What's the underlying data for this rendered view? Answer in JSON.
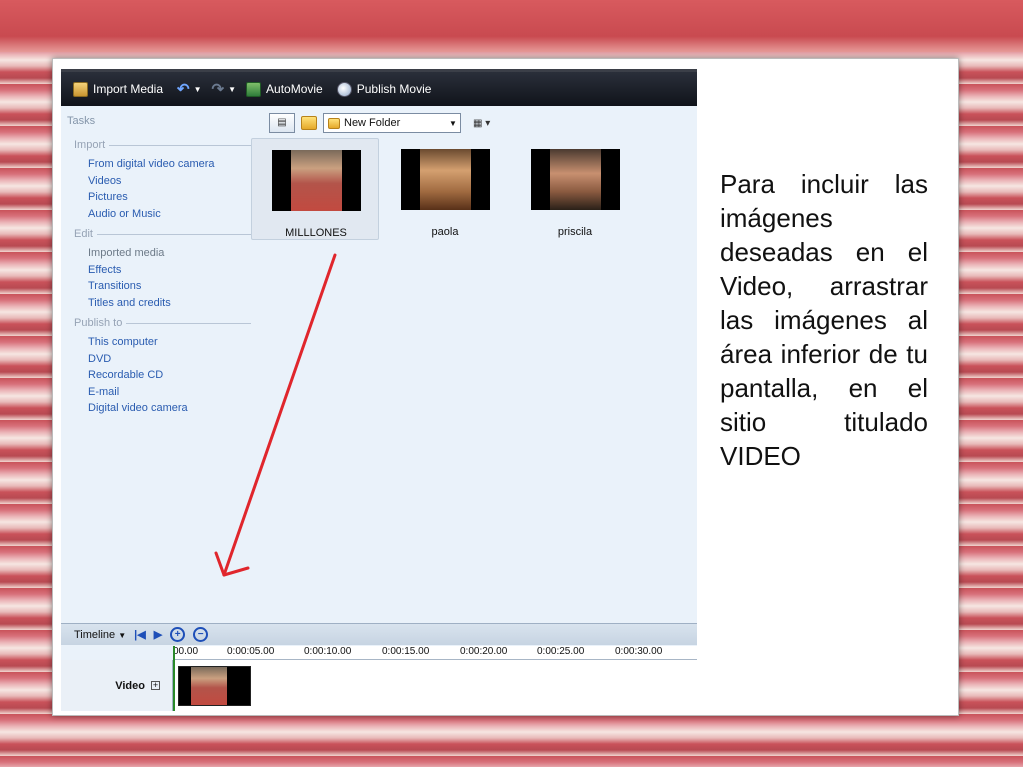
{
  "toolbar": {
    "import_media": "Import Media",
    "automovie": "AutoMovie",
    "publish_movie": "Publish Movie"
  },
  "tasks": {
    "title": "Tasks",
    "import": {
      "heading": "Import",
      "items": [
        "From digital video camera",
        "Videos",
        "Pictures",
        "Audio or Music"
      ]
    },
    "edit": {
      "heading": "Edit",
      "items": [
        "Imported media",
        "Effects",
        "Transitions",
        "Titles and credits"
      ]
    },
    "publish": {
      "heading": "Publish to",
      "items": [
        "This computer",
        "DVD",
        "Recordable CD",
        "E-mail",
        "Digital video camera"
      ]
    }
  },
  "content": {
    "folder": "New Folder",
    "media": [
      {
        "label": "MILLLONES",
        "selected": true
      },
      {
        "label": "paola",
        "selected": false
      },
      {
        "label": "priscila",
        "selected": false
      }
    ]
  },
  "timeline": {
    "label": "Timeline",
    "ticks": [
      "00.00",
      "0:00:05.00",
      "0:00:10.00",
      "0:00:15.00",
      "0:00:20.00",
      "0:00:25.00",
      "0:00:30.00"
    ],
    "video_track_label": "Video"
  },
  "caption": "Para incluir las imágenes deseadas en el Video, arrastrar las imágenes al área inferior de tu pantalla, en el sitio titulado VIDEO",
  "colors": {
    "arrow": "#e0262c",
    "link": "#2a5cb0",
    "toolbar_bg": "#10131a"
  }
}
